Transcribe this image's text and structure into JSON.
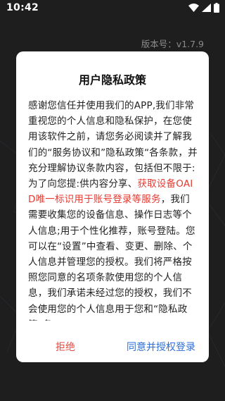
{
  "status_bar": {
    "time": "10:42",
    "icons": [
      "wifi-icon",
      "signal-icon",
      "battery-icon"
    ]
  },
  "version_text": "版本号：v1.7.9",
  "dialog": {
    "title": "用户隐私政策",
    "body_part1": "感谢您信任并使用我们的APP,我们非常重视您的个人信息和隐私保护，在您使用该软件之前，请您务必阅读并了解我们的“服务协议和”隐私政策“各条款，并充分理解协议条款内容，包括但不限于:为了向您提:供内容分享、",
    "body_highlight": "获取设备OAID唯一标识用于账号登录等服务",
    "body_part2": "，我们需要收集您的设备信息、操作日志等个人信息;用于个性化推荐，账号登陆。您可以在“设置”中查看、变更、删除、个人信息并管理您的授权。我们将严格按照您同意的名项条款使用您的个人信息，我们承诺未经过您的授权，我们不会使用您的个人信息用于您和“隐私政策”各",
    "refuse_label": "拒绝",
    "agree_label": "同意并授权登录"
  },
  "colors": {
    "highlight": "#e53a32",
    "refuse": "#e84a40",
    "agree": "#2f6fd6",
    "background": "#1e1e1e"
  }
}
